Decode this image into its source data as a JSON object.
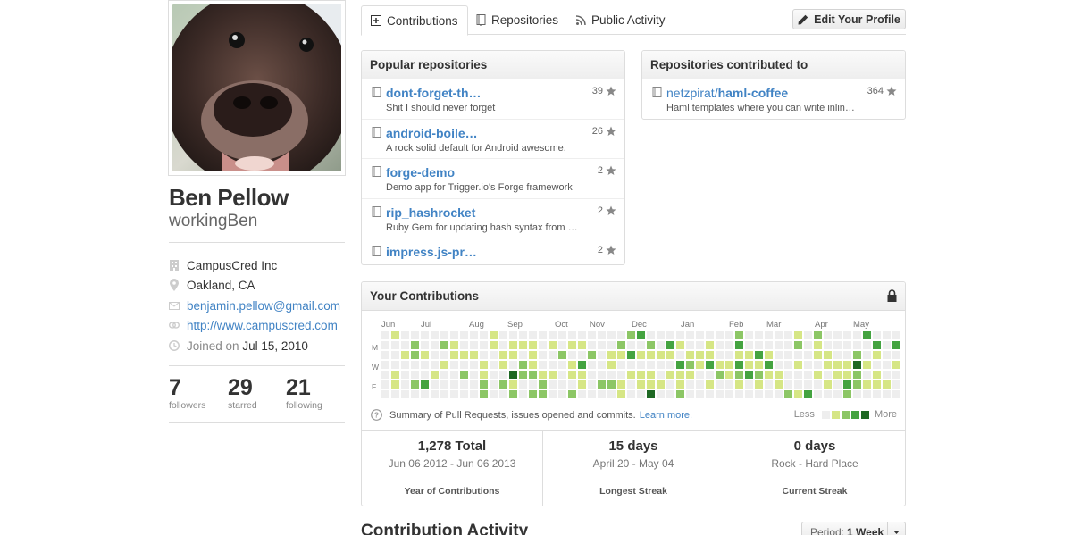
{
  "profile": {
    "name": "Ben Pellow",
    "username": "workingBen",
    "company": "CampusCred Inc",
    "location": "Oakland, CA",
    "email": "benjamin.pellow@gmail.com",
    "website": "http://www.campuscred.com",
    "joined_label": "Joined on",
    "joined_date": "Jul 15, 2010"
  },
  "stats": [
    {
      "num": "7",
      "label": "followers"
    },
    {
      "num": "29",
      "label": "starred"
    },
    {
      "num": "21",
      "label": "following"
    }
  ],
  "tabs": {
    "contributions": "Contributions",
    "repositories": "Repositories",
    "public_activity": "Public Activity"
  },
  "edit_profile_label": "Edit Your Profile",
  "popular": {
    "title": "Popular repositories",
    "items": [
      {
        "name": "dont-forget-th…",
        "desc": "Shit I should never forget",
        "stars": "39"
      },
      {
        "name": "android-boile…",
        "desc": "A rock solid default for Android awesome.",
        "stars": "26"
      },
      {
        "name": "forge-demo",
        "desc": "Demo app for Trigger.io's Forge framework",
        "stars": "2"
      },
      {
        "name": "rip_hashrocket",
        "desc": "Ruby Gem for updating hash syntax from …",
        "stars": "2"
      },
      {
        "name": "impress.js-pr…",
        "desc": "",
        "stars": "2"
      }
    ]
  },
  "contributed": {
    "title": "Repositories contributed to",
    "items": [
      {
        "owner": "netzpirat/",
        "name": "haml-coffee",
        "desc": "Haml templates where you can write inlin…",
        "stars": "364"
      }
    ]
  },
  "contrib": {
    "title": "Your Contributions",
    "months": [
      "Jun",
      "Jul",
      "Aug",
      "Sep",
      "Oct",
      "Nov",
      "Dec",
      "Jan",
      "Feb",
      "Mar",
      "Apr",
      "May"
    ],
    "day_labels": [
      "M",
      "W",
      "F"
    ],
    "summary": "Summary of Pull Requests, issues opened and commits.",
    "learn_more": "Learn more.",
    "legend_less": "Less",
    "legend_more": "More",
    "colors": [
      "#eeeeee",
      "#d6e685",
      "#8cc665",
      "#44a340",
      "#1e6823"
    ],
    "total": "1,278 Total",
    "total_range": "Jun 06 2012 - Jun 06 2013",
    "total_caption": "Year of Contributions",
    "longest": "15 days",
    "longest_range": "April 20 - May 04",
    "longest_caption": "Longest Streak",
    "current": "0 days",
    "current_range": "Rock - Hard Place",
    "current_caption": "Current Streak"
  },
  "activity": {
    "title": "Contribution Activity",
    "period_label": "Period:",
    "period_value": "1 Week"
  }
}
